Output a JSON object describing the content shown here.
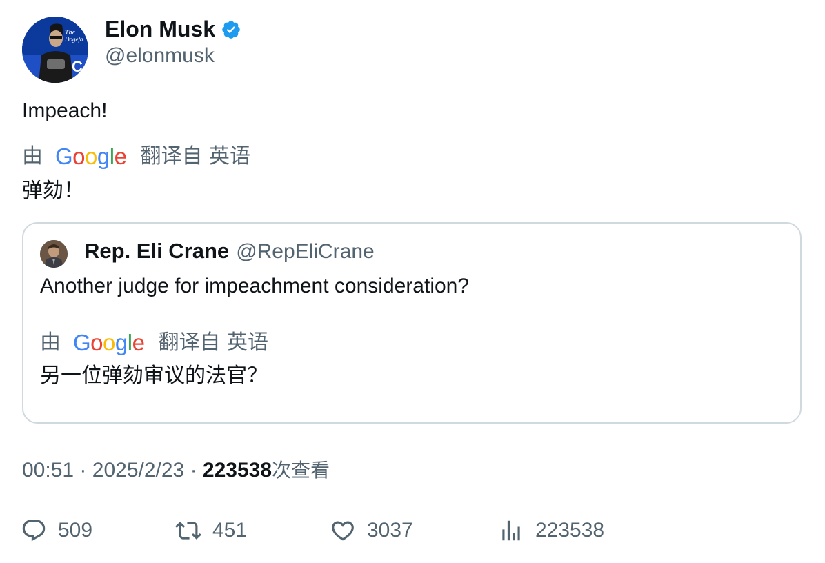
{
  "tweet": {
    "author_name": "Elon Musk",
    "author_handle": "@elonmusk",
    "text": "Impeach!",
    "translate_prefix": "由",
    "translate_brand": "Google",
    "translate_suffix": "翻译自 英语",
    "translated_text": "弹劾！"
  },
  "quoted": {
    "author_name": "Rep. Eli Crane",
    "author_handle": "@RepEliCrane",
    "text": "Another judge for impeachment consideration?",
    "translate_prefix": "由",
    "translate_brand": "Google",
    "translate_suffix": "翻译自 英语",
    "translated_text": "另一位弹劾审议的法官？"
  },
  "meta": {
    "time": "00:51",
    "sep": "·",
    "date": "2025/2/23",
    "views_count": "223538",
    "views_label": "次查看"
  },
  "actions": {
    "replies": "509",
    "reposts": "451",
    "likes": "3037",
    "views": "223538"
  },
  "colors": {
    "verified": "#1D9BF0",
    "secondary_text": "#536471",
    "primary_text": "#0f1419",
    "border": "#cfd9de"
  }
}
